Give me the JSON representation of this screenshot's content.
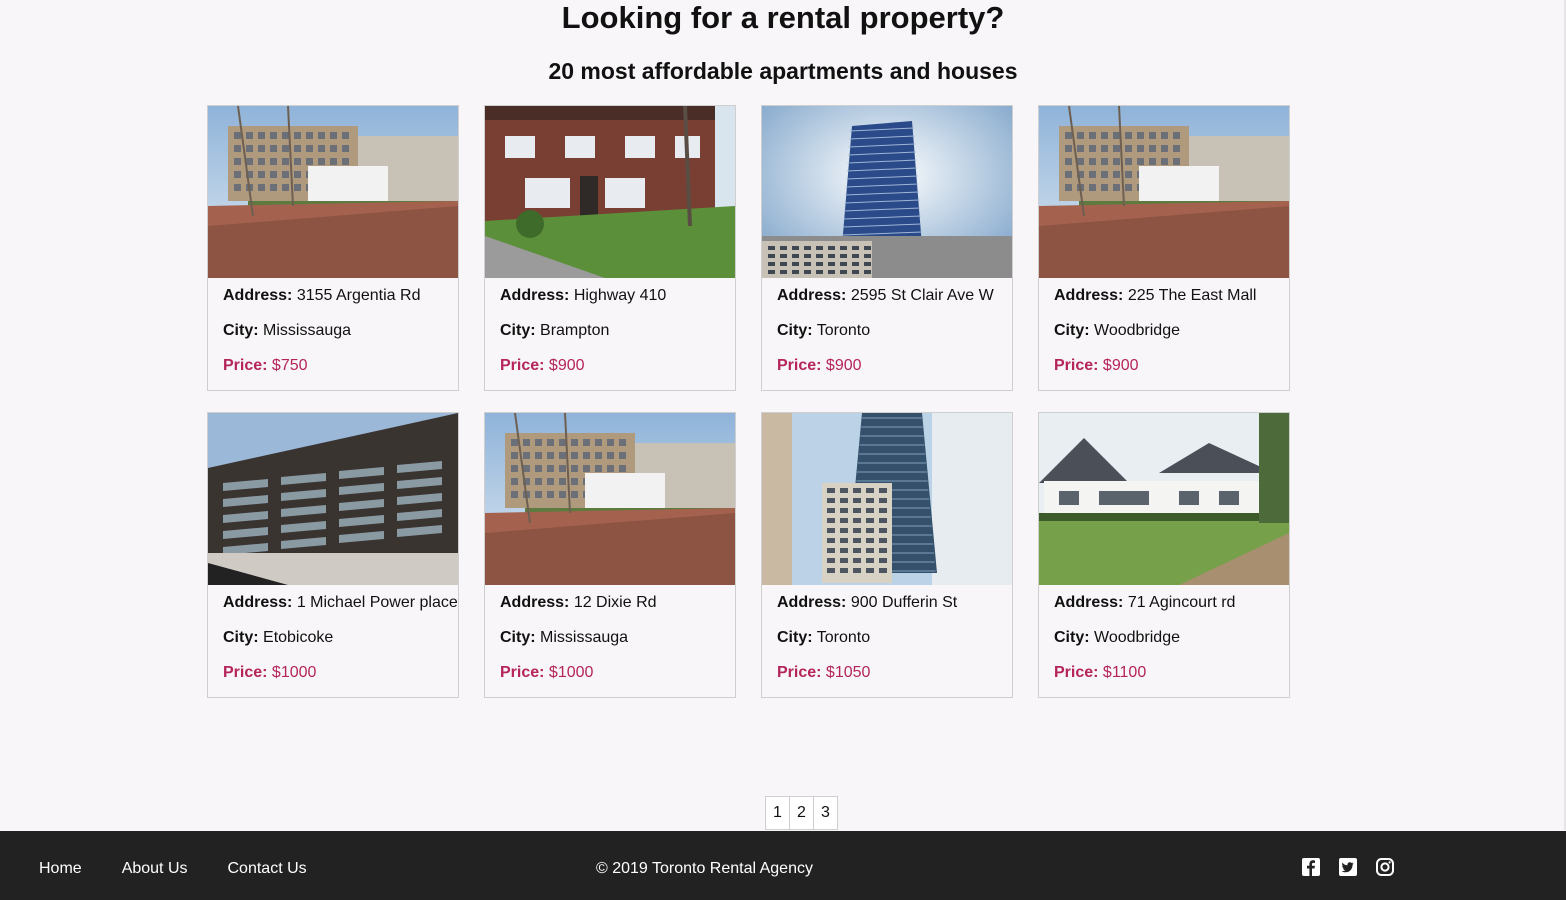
{
  "header": {
    "title": "Looking for a rental property?",
    "subtitle": "20 most affordable apartments and houses"
  },
  "labels": {
    "address": "Address:",
    "city": "City:",
    "price": "Price:"
  },
  "listings": [
    {
      "image": "apartment-block-photo",
      "address": "3155 Argentia Rd",
      "city": "Mississauga",
      "price": "$750"
    },
    {
      "image": "brick-rowhouse-photo",
      "address": "Highway 410",
      "city": "Brampton",
      "price": "$900"
    },
    {
      "image": "blue-tower-photo",
      "address": "2595 St Clair Ave W",
      "city": "Toronto",
      "price": "$900"
    },
    {
      "image": "apartment-block-photo",
      "address": "225 The East Mall",
      "city": "Woodbridge",
      "price": "$900"
    },
    {
      "image": "balcony-building-photo",
      "address": "1 Michael Power place",
      "city": "Etobicoke",
      "price": "$1000"
    },
    {
      "image": "apartment-block-photo",
      "address": "12 Dixie Rd",
      "city": "Mississauga",
      "price": "$1000"
    },
    {
      "image": "glass-tower-photo",
      "address": "900 Dufferin St",
      "city": "Toronto",
      "price": "$1050"
    },
    {
      "image": "white-house-photo",
      "address": "71 Agincourt rd",
      "city": "Woodbridge",
      "price": "$1100"
    }
  ],
  "pagination": [
    "1",
    "2",
    "3"
  ],
  "footer": {
    "nav": [
      "Home",
      "About Us",
      "Contact Us"
    ],
    "copyright": "© 2019 Toronto Rental Agency",
    "social": [
      "facebook-icon",
      "twitter-icon",
      "instagram-icon"
    ]
  },
  "colors": {
    "price": "#b5245b",
    "footer_bg": "#222222",
    "page_bg": "#f8f6f8"
  }
}
